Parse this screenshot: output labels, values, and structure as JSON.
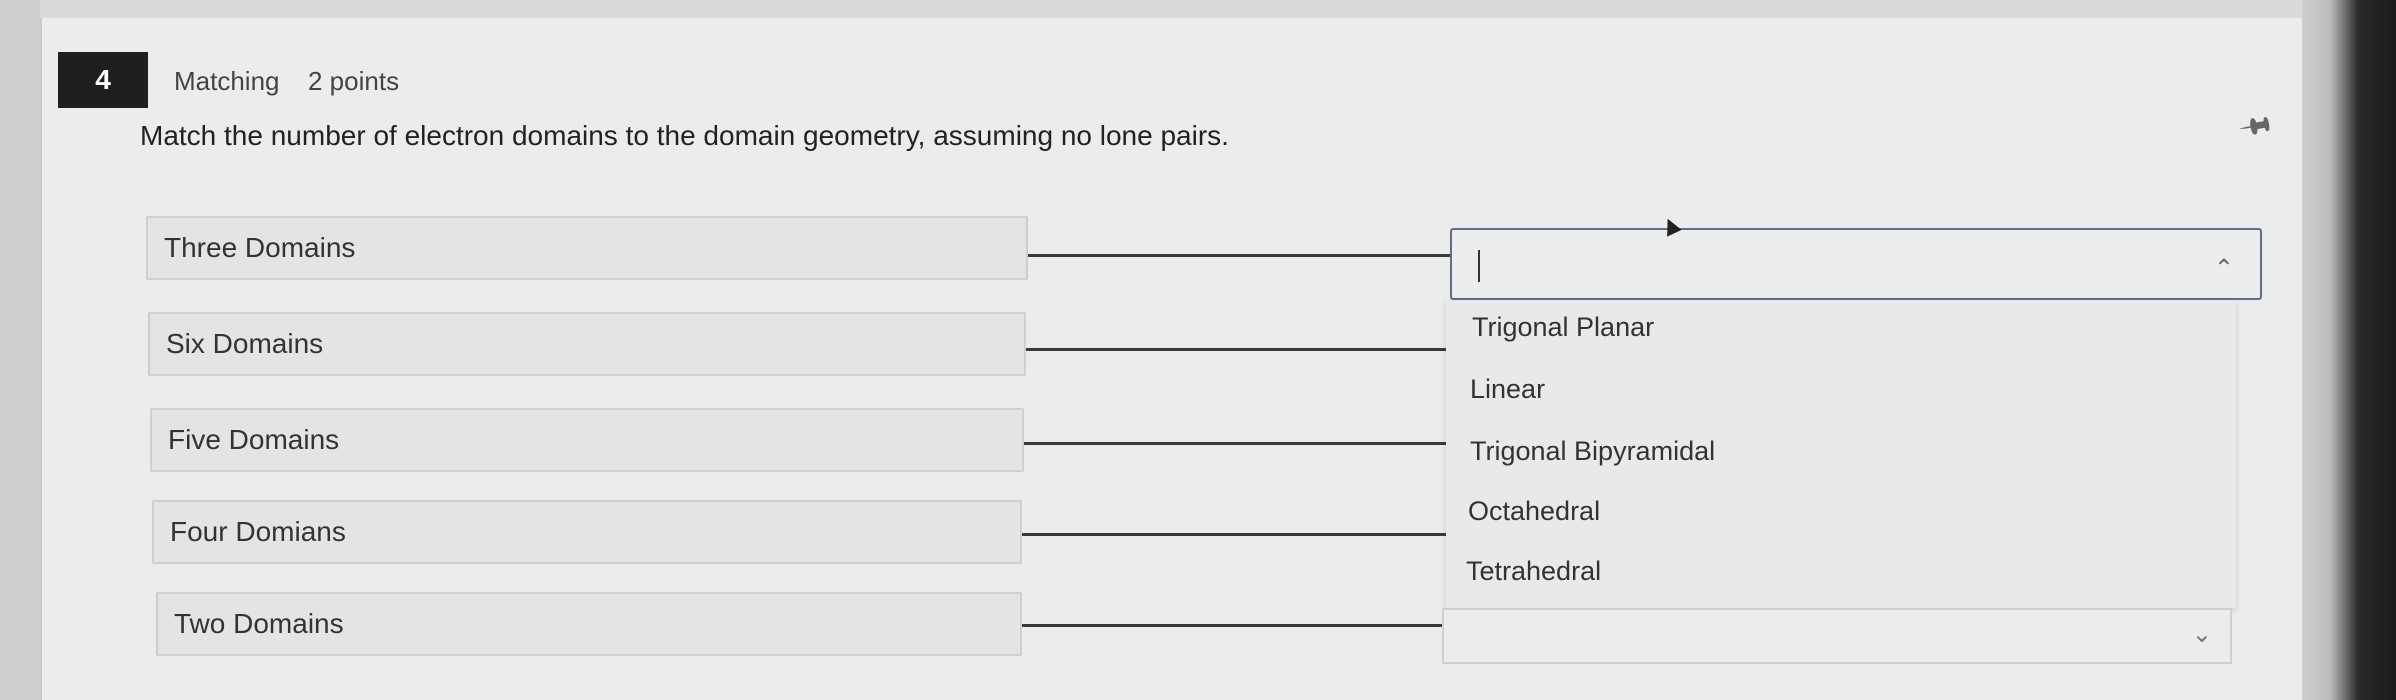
{
  "question": {
    "number": "4",
    "type": "Matching",
    "points": "2 points",
    "prompt": "Match the number of electron domains to the domain geometry, assuming no lone pairs."
  },
  "terms": [
    {
      "label": "Three Domains"
    },
    {
      "label": "Six Domains"
    },
    {
      "label": "Five Domains"
    },
    {
      "label": "Four Domians"
    },
    {
      "label": "Two Domains"
    }
  ],
  "open_dropdown": {
    "value": "",
    "options": [
      "Trigonal Planar",
      "Linear",
      "Trigonal Bipyramidal",
      "Octahedral",
      "Tetrahedral"
    ]
  },
  "icons": {
    "pin": "pin-icon",
    "chevron_up": "chevron-up-icon",
    "chevron_down": "chevron-down-icon"
  }
}
